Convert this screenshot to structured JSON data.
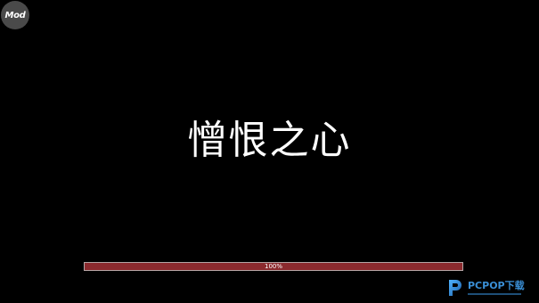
{
  "badge": {
    "label": "Mod"
  },
  "title": {
    "text": "憎恨之心"
  },
  "loading": {
    "progress_label": "100%",
    "progress_fraction": 1.0
  },
  "watermark": {
    "text": "PCPOP下载",
    "icon": "pcpop-logo-icon"
  },
  "colors": {
    "background": "#000000",
    "progress_fill": "#8b2a2e",
    "progress_border": "#b5a5a5",
    "watermark_accent": "#3a8fd6"
  }
}
